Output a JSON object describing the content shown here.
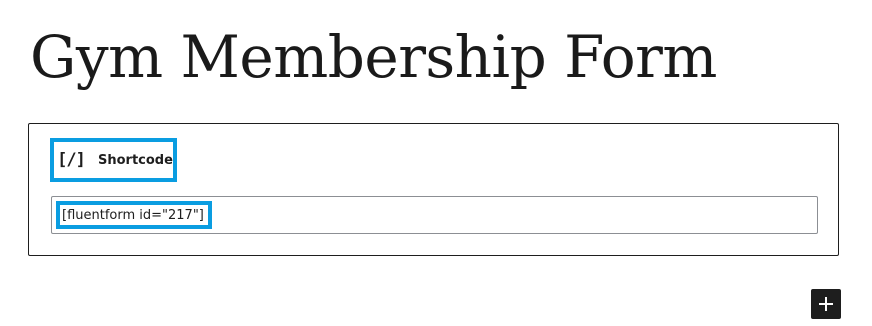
{
  "page": {
    "title": "Gym Membership Form"
  },
  "block": {
    "icon_glyph": "[/]",
    "icon_name": "shortcode-icon",
    "name": "Shortcode",
    "value": "[fluentform id=\"217\"]",
    "highlight_color": "#0a9de1"
  },
  "inserter": {
    "icon_name": "plus-icon",
    "color": "#1e1e1e"
  }
}
